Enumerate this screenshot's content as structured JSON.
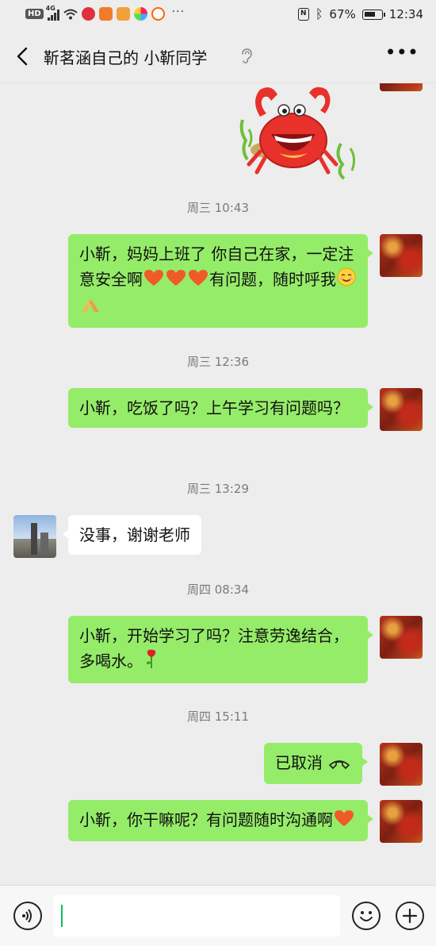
{
  "status_bar": {
    "hd": "HD",
    "network": "4G",
    "battery_pct": "67%",
    "time": "12:34"
  },
  "header": {
    "title": "靳茗涵自己的 小靳同学"
  },
  "messages": [
    {
      "type": "time",
      "text": "周三 10:43"
    },
    {
      "type": "sent",
      "text": "小靳，妈妈上班了 你自己在家，一定注意安全啊"
    },
    {
      "type": "sent_tail",
      "text": "有问题，随时呼我"
    },
    {
      "type": "time",
      "text": "周三 12:36"
    },
    {
      "type": "sent",
      "text": "小靳，吃饭了吗？上午学习有问题吗？"
    },
    {
      "type": "time",
      "text": "周三 13:29"
    },
    {
      "type": "received",
      "text": "没事，谢谢老师"
    },
    {
      "type": "time",
      "text": "周四 08:34"
    },
    {
      "type": "sent",
      "text": "小靳，开始学习了吗？注意劳逸结合，多喝水。"
    },
    {
      "type": "time",
      "text": "周四 15:11"
    },
    {
      "type": "call",
      "text": "已取消"
    },
    {
      "type": "sent",
      "text": "小靳，你干嘛呢？有问题随时沟通啊"
    }
  ],
  "icons": {
    "back": "back-arrow-icon",
    "ear": "ear-icon",
    "more": "more-icon",
    "voice": "voice-icon",
    "emoji": "emoji-icon",
    "plus": "plus-icon",
    "heart": "heart-emoji",
    "smile": "smile-emoji",
    "pray": "pray-emoji",
    "rose": "rose-emoji",
    "call": "call-icon",
    "crab": "crab-sticker"
  },
  "colors": {
    "sent_bubble": "#95ec69",
    "received_bubble": "#ffffff",
    "background": "#ededed",
    "caret": "#07c160"
  }
}
